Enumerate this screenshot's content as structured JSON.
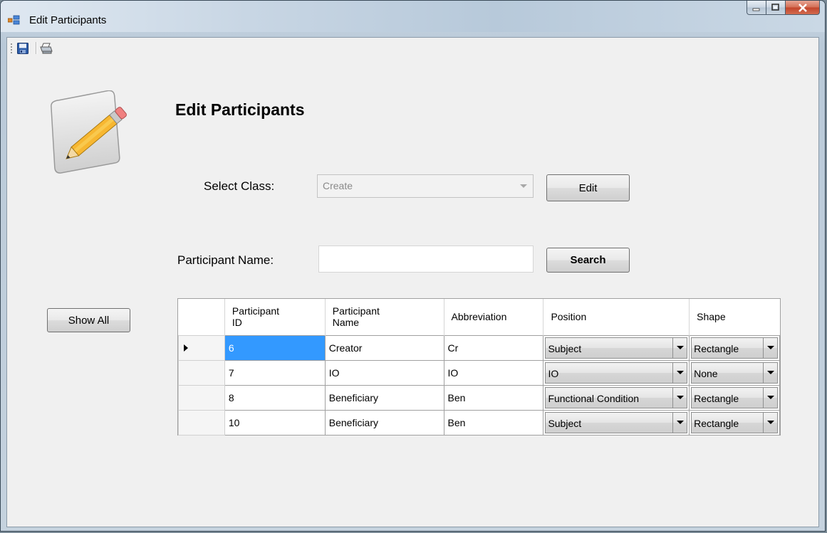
{
  "window": {
    "title": "Edit Participants",
    "app_icon": "form-icon"
  },
  "toolbar": {
    "save_icon": "save-icon",
    "print_icon": "print-icon"
  },
  "main": {
    "heading": "Edit Participants",
    "logo_icon": "edit-pencil-icon",
    "select_class_label": "Select Class:",
    "select_class_value": "Create",
    "edit_button": "Edit",
    "participant_name_label": "Participant Name:",
    "participant_name_value": "",
    "search_button": "Search",
    "show_all_button": "Show All"
  },
  "grid": {
    "columns": [
      {
        "line1": "Participant",
        "line2": "ID"
      },
      {
        "line1": "Participant",
        "line2": "Name"
      },
      {
        "line1": "Abbreviation",
        "line2": ""
      },
      {
        "line1": "Position",
        "line2": ""
      },
      {
        "line1": "Shape",
        "line2": ""
      }
    ],
    "rows": [
      {
        "id": "6",
        "name": "Creator",
        "abbreviation": "Cr",
        "position": "Subject",
        "shape": "Rectangle"
      },
      {
        "id": "7",
        "name": "IO",
        "abbreviation": "IO",
        "position": "IO",
        "shape": "None"
      },
      {
        "id": "8",
        "name": "Beneficiary",
        "abbreviation": "Ben",
        "position": "Functional Condition",
        "shape": "Rectangle"
      },
      {
        "id": "10",
        "name": "Beneficiary",
        "abbreviation": "Ben",
        "position": "Subject",
        "shape": "Rectangle"
      }
    ]
  },
  "colors": {
    "selection": "#3399ff",
    "close_button": "#c2442b"
  }
}
